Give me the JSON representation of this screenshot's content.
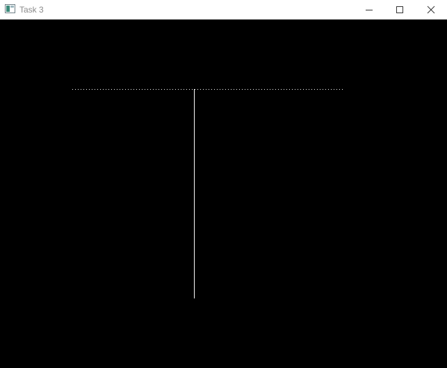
{
  "window": {
    "title": "Task 3",
    "app_icon": "window-app-icon",
    "controls": {
      "minimize_icon": "minimize-icon",
      "maximize_icon": "maximize-icon",
      "close_icon": "close-icon"
    }
  },
  "canvas": {
    "background": "#000000",
    "stroke_color": "#ffffff",
    "shapes": [
      {
        "kind": "dotted-horizontal-line",
        "name": "dotted-horizontal-line"
      },
      {
        "kind": "solid-vertical-line",
        "name": "vertical-line"
      }
    ]
  }
}
